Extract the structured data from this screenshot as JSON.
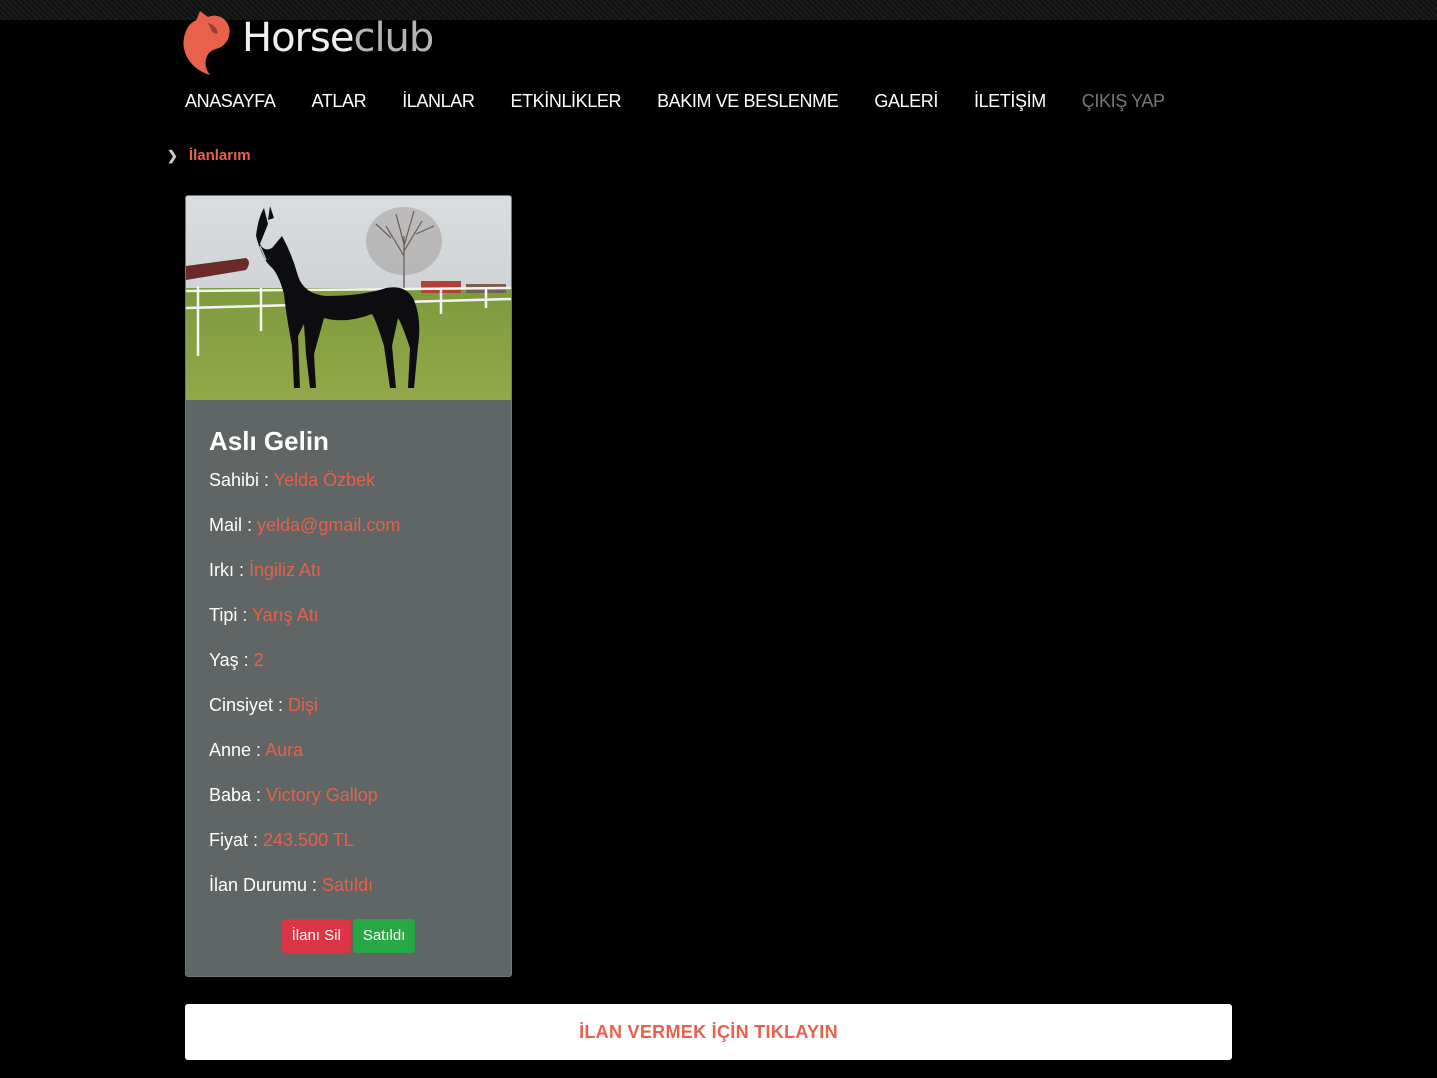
{
  "brand": {
    "logo_part1": "Horse",
    "logo_part2": "club",
    "accent": "#e8614a"
  },
  "nav": {
    "items": [
      {
        "label": "ANASAYFA"
      },
      {
        "label": "ATLAR"
      },
      {
        "label": "İLANLAR"
      },
      {
        "label": "ETKİNLİKLER"
      },
      {
        "label": "BAKIM VE BESLENME"
      },
      {
        "label": "GALERİ"
      },
      {
        "label": "İLETİŞİM"
      },
      {
        "label": "ÇIKIŞ YAP"
      }
    ]
  },
  "breadcrumb": {
    "current": "İlanlarım"
  },
  "listing": {
    "title": "Aslı Gelin",
    "fields": [
      {
        "label": "Sahibi : ",
        "value": "Yelda Özbek"
      },
      {
        "label": "Mail : ",
        "value": "yelda@gmail.com"
      },
      {
        "label": "Irkı : ",
        "value": "İngiliz Atı"
      },
      {
        "label": "Tipi : ",
        "value": "Yarış Atı"
      },
      {
        "label": "Yaş : ",
        "value": "2"
      },
      {
        "label": "Cinsiyet : ",
        "value": "Dişi"
      },
      {
        "label": "Anne : ",
        "value": "Aura"
      },
      {
        "label": "Baba : ",
        "value": "Victory Gallop"
      },
      {
        "label": "Fiyat : ",
        "value": "243.500 TL"
      },
      {
        "label": "İlan Durumu : ",
        "value": "Satıldı"
      }
    ],
    "delete_label": "İlanı Sil",
    "sold_label": "Satıldı"
  },
  "cta": {
    "label": "İLAN VERMEK İÇİN TIKLAYIN"
  }
}
